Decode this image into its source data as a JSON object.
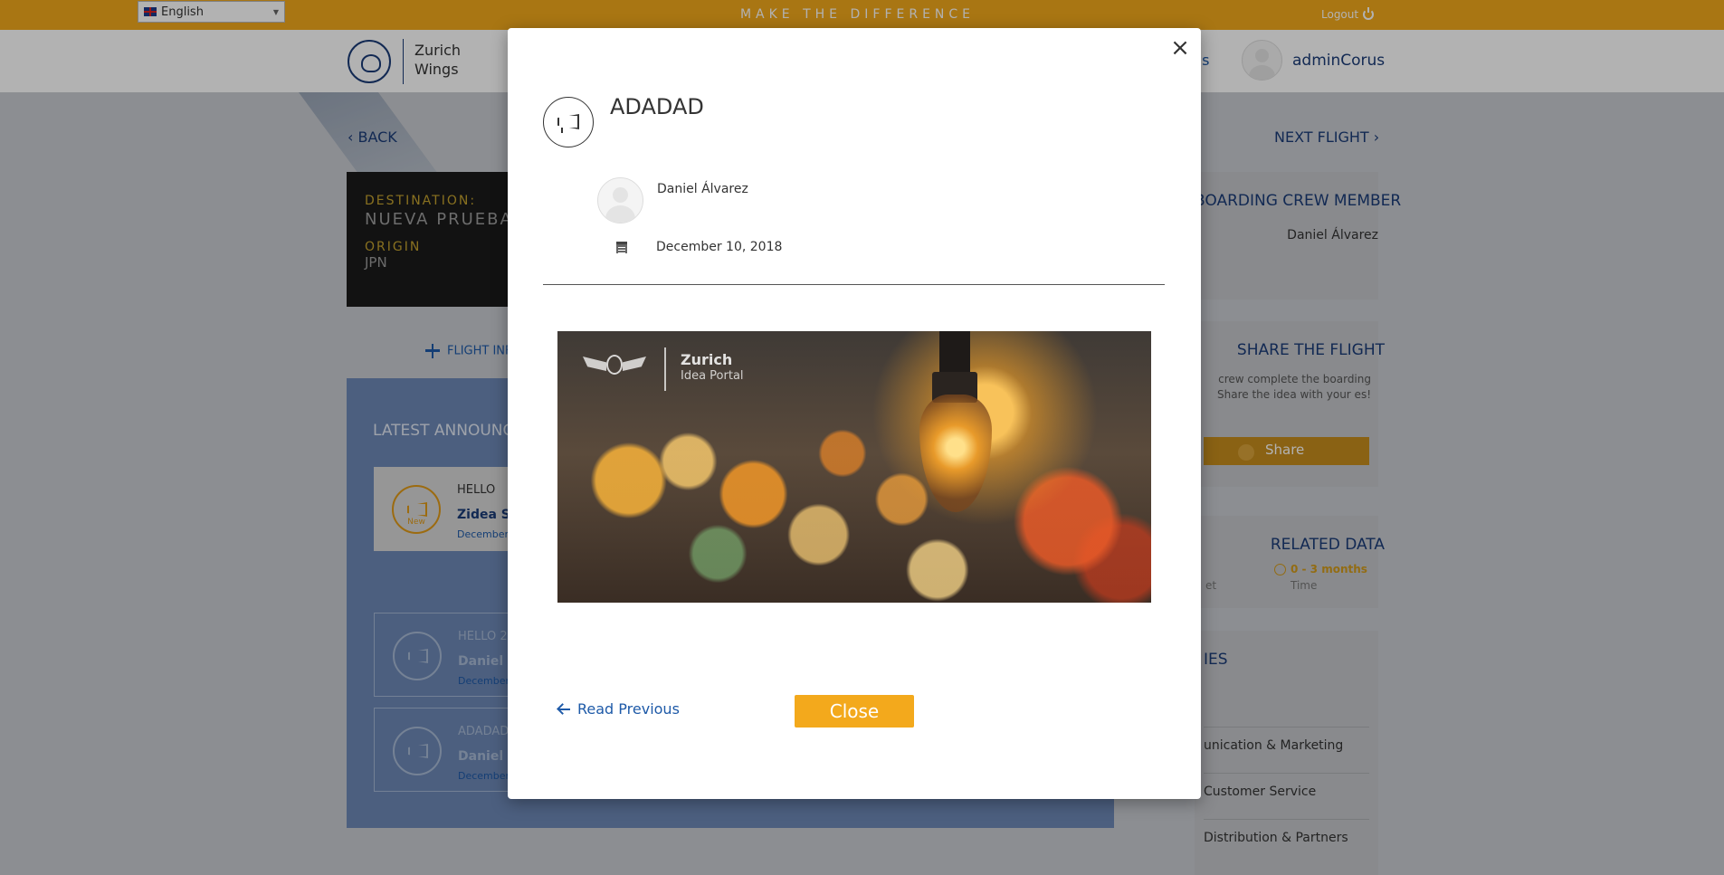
{
  "topbar": {
    "language": "English",
    "tagline": "MAKE THE DIFFERENCE",
    "logout": "Logout"
  },
  "header": {
    "logo_line1": "Zurich",
    "logo_line2": "Wings",
    "nav_fragment": "ds",
    "username": "adminCorus"
  },
  "page": {
    "back": "BACK",
    "next": "NEXT FLIGHT",
    "destination_label": "DESTINATION:",
    "destination_value": "NUEVA PRUEBA",
    "origin_label": "ORIGIN",
    "origin_value": "JPN",
    "flight_tab": "FLIGHT INFO",
    "announcements_title": "LATEST ANNOUNCEMENTS",
    "announcements": [
      {
        "title": "HELLO",
        "author": "Zidea Su",
        "date": "December",
        "new_label": "New"
      },
      {
        "title": "HELLO 2",
        "author": "Daniel Á",
        "date": "December"
      },
      {
        "title": "ADADAD",
        "author": "Daniel Á",
        "date": "December"
      }
    ]
  },
  "right": {
    "crew_title": "BOARDING CREW MEMBER",
    "crew_name": "Daniel Álvarez",
    "share_title": "SHARE THE FLIGHT",
    "share_text": "crew complete the boarding Share the idea with your es!",
    "share_btn": "Share",
    "data_title": "RELATED DATA",
    "target_label": "et",
    "time_value": "0 - 3 months",
    "time_label": "Time",
    "cat_title": "IES",
    "categories": [
      "unication & Marketing",
      "Customer Service",
      "Distribution & Partners"
    ]
  },
  "modal": {
    "title": "ADADAD",
    "author": "Daniel Álvarez",
    "date": "December 10, 2018",
    "image_brand": "Zurich",
    "image_sub": "Idea Portal",
    "read_previous": "Read Previous",
    "close": "Close"
  },
  "colors": {
    "accent": "#f3a91c",
    "brand_blue": "#1b3c78",
    "link_blue": "#1e5aa8"
  }
}
